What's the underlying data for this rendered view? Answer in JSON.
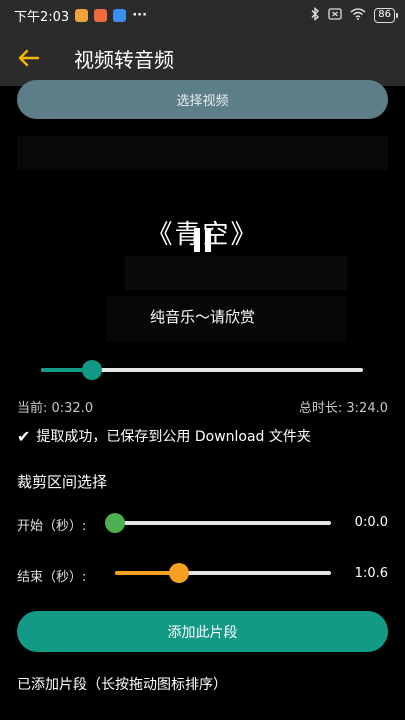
{
  "status_bar": {
    "time": "下午2:03",
    "more": "···",
    "battery": "86"
  },
  "app_bar": {
    "title": "视频转音频"
  },
  "select_video_label": "选择视频",
  "video": {
    "song_title": "《青空》",
    "subtitle": "纯音乐～请欣赏"
  },
  "playback": {
    "current_label": "当前: 0:32.0",
    "total_label": "总时长: 3:24.0",
    "progress_fraction": 0.157
  },
  "status_message": "提取成功，已保存到公用 Download 文件夹",
  "trim": {
    "heading": "裁剪区间选择",
    "start_label": "开始（秒）:",
    "start_value": "0:0.0",
    "start_fraction": 0.0,
    "end_label": "结束（秒）:",
    "end_value": "1:0.6",
    "end_fraction": 0.297
  },
  "add_segment_label": "添加此片段",
  "added_segments_heading": "已添加片段（长按拖动图标排序）",
  "colors": {
    "accent_teal": "#139a84",
    "accent_orange": "#f5a020",
    "accent_green": "#4caf50",
    "back_arrow": "#f5b800"
  }
}
